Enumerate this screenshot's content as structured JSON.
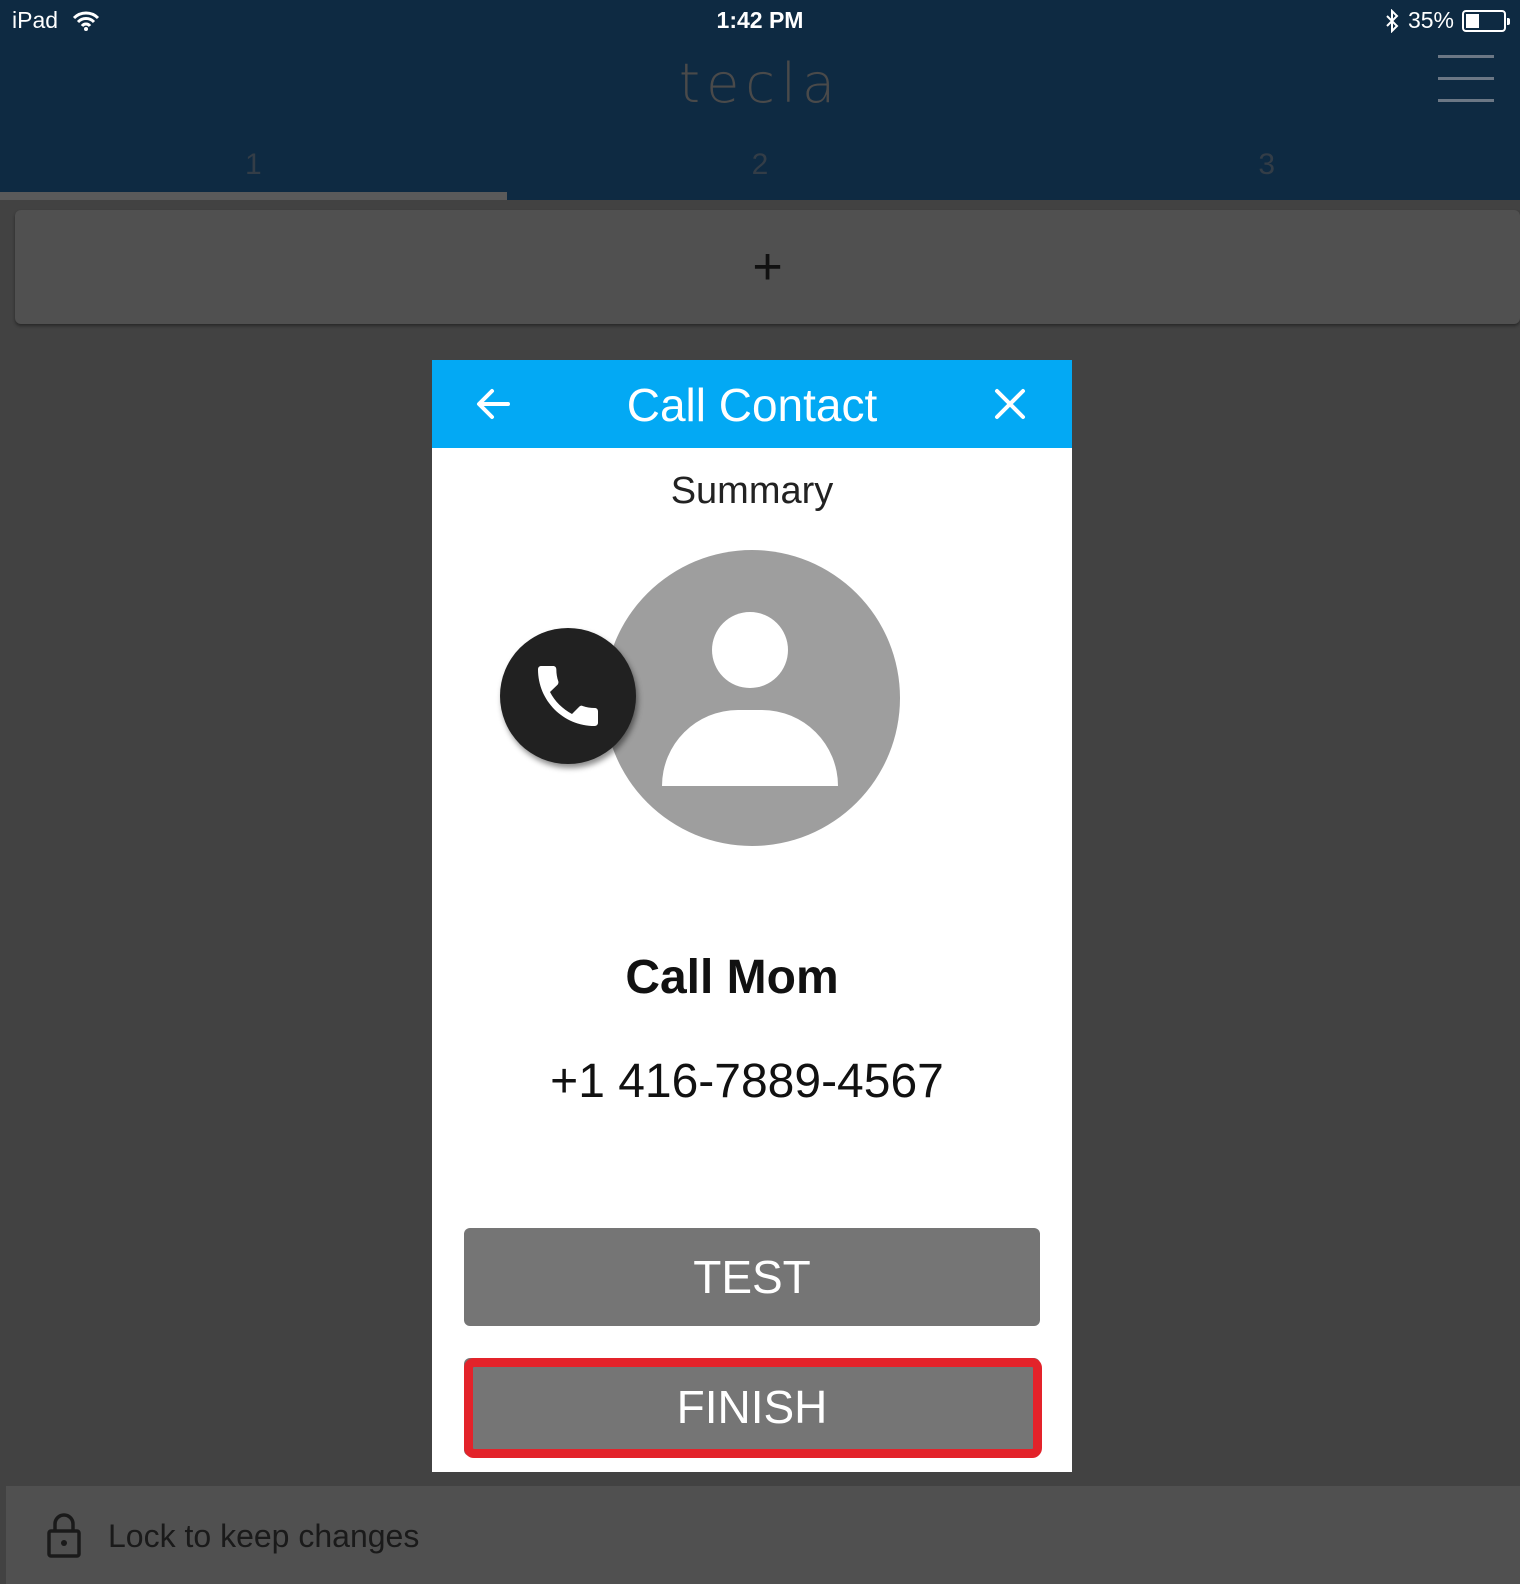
{
  "status_bar": {
    "device": "iPad",
    "time": "1:42 PM",
    "battery": "35%",
    "battery_level": 0.35
  },
  "app": {
    "logo": "tecla"
  },
  "tabs": [
    {
      "label": "1",
      "active": true
    },
    {
      "label": "2",
      "active": false
    },
    {
      "label": "3",
      "active": false
    }
  ],
  "add_tile": {
    "symbol": "+"
  },
  "modal": {
    "title": "Call Contact",
    "subtitle": "Summary",
    "contact_name": "Call Mom",
    "contact_number": "+1 416-7889-4567",
    "test_label": "TEST",
    "finish_label": "FINISH"
  },
  "footer": {
    "lock_label": "Lock to keep changes"
  },
  "colors": {
    "header_bg": "#0e2a42",
    "modal_header": "#03a9f4",
    "button_gray": "#757575",
    "highlight": "#e3232a"
  },
  "icons": [
    "wifi-icon",
    "bluetooth-icon",
    "battery-icon",
    "hamburger-menu-icon",
    "plus-icon",
    "back-arrow-icon",
    "close-icon",
    "contact-avatar-icon",
    "phone-icon",
    "lock-icon"
  ]
}
